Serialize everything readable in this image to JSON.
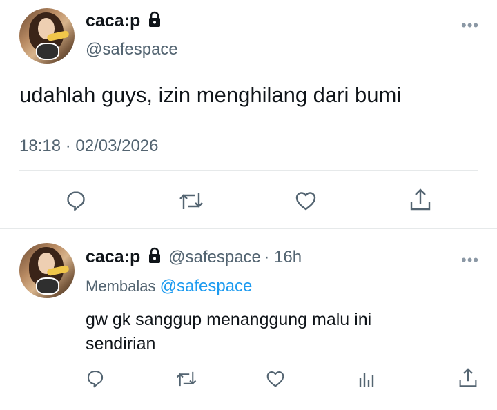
{
  "main_tweet": {
    "display_name": "caca:p",
    "handle": "@safespace",
    "text": "udahlah guys, izin menghilang dari bumi",
    "timestamp": "18:18 · 02/03/2026",
    "more_icon": "more-dots-icon",
    "actions": [
      "reply-icon",
      "retweet-icon",
      "like-icon",
      "share-icon"
    ]
  },
  "reply": {
    "display_name": "caca:p",
    "handle": "@safespace",
    "age": "16h",
    "replying_label": "Membalas",
    "replying_to": "@safespace",
    "text_line1": "gw gk sanggup menanggung malu ini",
    "text_line2": "sendirian",
    "actions": [
      "reply-icon",
      "retweet-icon",
      "like-icon",
      "analytics-icon",
      "share-icon"
    ]
  },
  "colors": {
    "link": "#1d9bf0",
    "secondary": "#536471",
    "primary": "#0f1419"
  }
}
